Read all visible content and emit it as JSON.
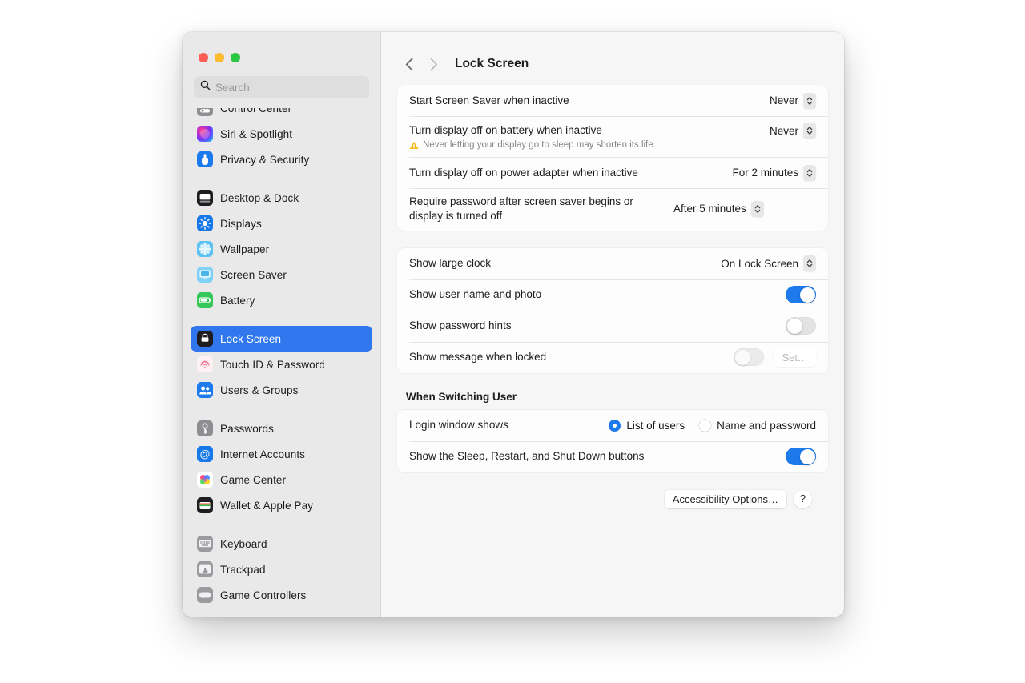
{
  "window": {
    "traffic_lights": [
      "close",
      "minimize",
      "zoom"
    ],
    "colors": {
      "accent": "#1c7aed",
      "selection": "#3077ed",
      "warning": "#f5b912"
    }
  },
  "search": {
    "placeholder": "Search",
    "value": "",
    "icon": "search-icon"
  },
  "sidebar": {
    "items": [
      {
        "label": "Control Center",
        "icon": "control-center-icon",
        "selected": false,
        "clipped": true
      },
      {
        "label": "Siri & Spotlight",
        "icon": "siri-icon",
        "selected": false
      },
      {
        "label": "Privacy & Security",
        "icon": "privacy-security-icon",
        "selected": false
      },
      {
        "gap": true
      },
      {
        "label": "Desktop & Dock",
        "icon": "desktop-dock-icon",
        "selected": false
      },
      {
        "label": "Displays",
        "icon": "displays-icon",
        "selected": false
      },
      {
        "label": "Wallpaper",
        "icon": "wallpaper-icon",
        "selected": false
      },
      {
        "label": "Screen Saver",
        "icon": "screen-saver-icon",
        "selected": false
      },
      {
        "label": "Battery",
        "icon": "battery-icon",
        "selected": false
      },
      {
        "gap": true
      },
      {
        "label": "Lock Screen",
        "icon": "lock-screen-icon",
        "selected": true
      },
      {
        "label": "Touch ID & Password",
        "icon": "touch-id-icon",
        "selected": false
      },
      {
        "label": "Users & Groups",
        "icon": "users-groups-icon",
        "selected": false
      },
      {
        "gap": true
      },
      {
        "label": "Passwords",
        "icon": "passwords-icon",
        "selected": false
      },
      {
        "label": "Internet Accounts",
        "icon": "internet-accounts-icon",
        "selected": false
      },
      {
        "label": "Game Center",
        "icon": "game-center-icon",
        "selected": false
      },
      {
        "label": "Wallet & Apple Pay",
        "icon": "wallet-icon",
        "selected": false
      },
      {
        "gap": true
      },
      {
        "label": "Keyboard",
        "icon": "keyboard-icon",
        "selected": false
      },
      {
        "label": "Trackpad",
        "icon": "trackpad-icon",
        "selected": false
      },
      {
        "label": "Game Controllers",
        "icon": "game-controllers-icon",
        "selected": false,
        "clipped": true
      }
    ]
  },
  "header": {
    "back_icon": "chevron-left-icon",
    "forward_icon": "chevron-right-icon",
    "title": "Lock Screen"
  },
  "groups": {
    "timing": [
      {
        "label": "Start Screen Saver when inactive",
        "control": "popup",
        "value": "Never"
      },
      {
        "label": "Turn display off on battery when inactive",
        "control": "popup",
        "value": "Never",
        "warning": "Never letting your display go to sleep may shorten its life."
      },
      {
        "label": "Turn display off on power adapter when inactive",
        "control": "popup",
        "value": "For 2 minutes"
      },
      {
        "label": "Require password after screen saver begins or display is turned off",
        "control": "popup",
        "value": "After 5 minutes"
      }
    ],
    "appearance": [
      {
        "label": "Show large clock",
        "control": "popup",
        "value": "On Lock Screen"
      },
      {
        "label": "Show user name and photo",
        "control": "toggle",
        "value": "on"
      },
      {
        "label": "Show password hints",
        "control": "toggle",
        "value": "off"
      },
      {
        "label": "Show message when locked",
        "control": "toggle",
        "value": "off",
        "button": "Set…",
        "button_disabled": true
      }
    ]
  },
  "switching_user": {
    "section_title": "When Switching User",
    "login_window": {
      "label": "Login window shows",
      "options": [
        {
          "label": "List of users",
          "selected": true
        },
        {
          "label": "Name and password",
          "selected": false
        }
      ]
    },
    "power_buttons": {
      "label": "Show the Sleep, Restart, and Shut Down buttons",
      "value": "on"
    }
  },
  "footer": {
    "accessibility_button": "Accessibility Options…",
    "help_button": "?"
  }
}
